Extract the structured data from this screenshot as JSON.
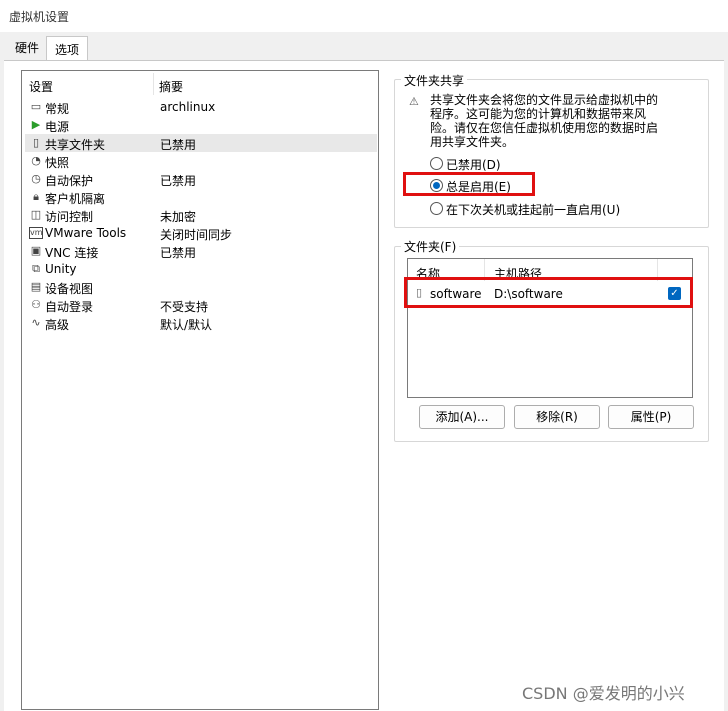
{
  "window": {
    "title": "虚拟机设置"
  },
  "tabs": [
    {
      "label": "硬件"
    },
    {
      "label": "选项"
    }
  ],
  "settings_list": {
    "header_setting": "设置",
    "header_summary": "摘要",
    "items": [
      {
        "icon": "monitor-icon",
        "name": "常规",
        "summary": "archlinux"
      },
      {
        "icon": "play-icon",
        "name": "电源",
        "summary": ""
      },
      {
        "icon": "shared-folder-icon",
        "name": "共享文件夹",
        "summary": "已禁用"
      },
      {
        "icon": "snapshot-icon",
        "name": "快照",
        "summary": ""
      },
      {
        "icon": "autoprotect-icon",
        "name": "自动保护",
        "summary": "已禁用"
      },
      {
        "icon": "lock-icon",
        "name": "客户机隔离",
        "summary": ""
      },
      {
        "icon": "access-control-icon",
        "name": "访问控制",
        "summary": "未加密"
      },
      {
        "icon": "vm-icon",
        "name": "VMware Tools",
        "summary": "关闭时间同步"
      },
      {
        "icon": "vnc-icon",
        "name": "VNC 连接",
        "summary": "已禁用"
      },
      {
        "icon": "unity-icon",
        "name": "Unity",
        "summary": ""
      },
      {
        "icon": "device-view-icon",
        "name": "设备视图",
        "summary": ""
      },
      {
        "icon": "autologin-icon",
        "name": "自动登录",
        "summary": "不受支持"
      },
      {
        "icon": "advanced-icon",
        "name": "高级",
        "summary": "默认/默认"
      }
    ]
  },
  "folder_sharing": {
    "title": "文件夹共享",
    "warning": "共享文件夹会将您的文件显示给虚拟机中的程序。这可能为您的计算机和数据带来风险。请仅在您信任虚拟机使用您的数据时启用共享文件夹。",
    "options": [
      {
        "label": "已禁用(D)",
        "selected": false
      },
      {
        "label": "总是启用(E)",
        "selected": true
      },
      {
        "label": "在下次关机或挂起前一直启用(U)",
        "selected": false
      }
    ]
  },
  "folders": {
    "title": "文件夹(F)",
    "col_name": "名称",
    "col_path": "主机路径",
    "rows": [
      {
        "name": "software",
        "path": "D:\\software",
        "enabled": true
      }
    ],
    "buttons": {
      "add": "添加(A)...",
      "remove": "移除(R)",
      "properties": "属性(P)"
    }
  },
  "watermark": "CSDN @爱发明的小兴"
}
